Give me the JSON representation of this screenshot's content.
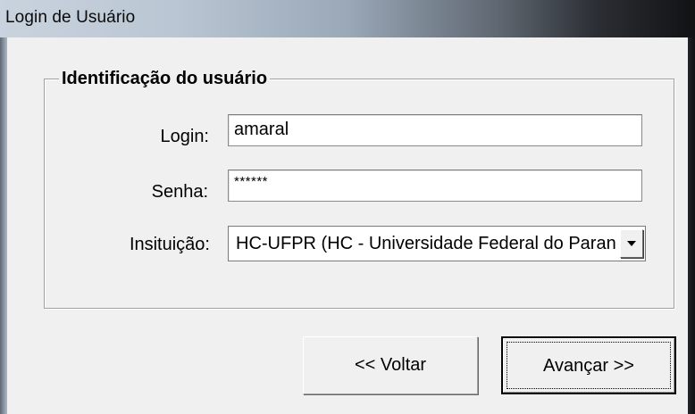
{
  "window": {
    "title": "Login de Usuário"
  },
  "group": {
    "legend": "Identificação do usuário"
  },
  "form": {
    "login_label": "Login:",
    "login_value": "amaral",
    "senha_label": "Senha:",
    "senha_value": "******",
    "instituicao_label": "Insituição:",
    "instituicao_value": "HC-UFPR (HC - Universidade Federal do Paraná)"
  },
  "buttons": {
    "back_label": "<< Voltar",
    "next_label": "Avançar >>"
  },
  "icons": {
    "dropdown": "chevron-down-icon"
  }
}
